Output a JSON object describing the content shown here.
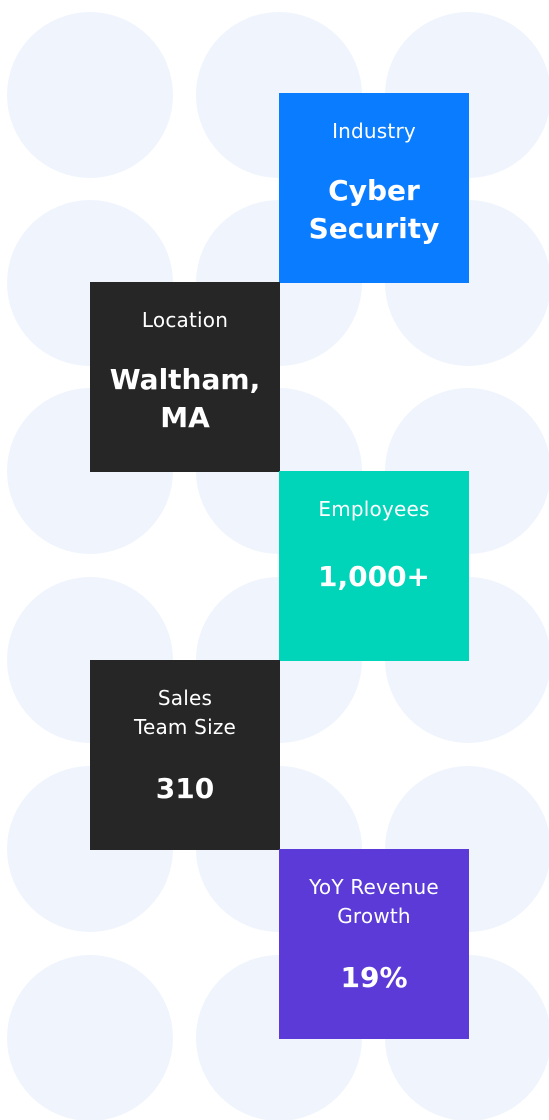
{
  "colors": {
    "circle": "#eff4fd",
    "industry_bg": "#0a7cff",
    "location_bg": "#262626",
    "employees_bg": "#00d4b9",
    "sales_bg": "#262626",
    "growth_bg": "#5b3ad8",
    "text": "#ffffff"
  },
  "stats": {
    "industry": {
      "label": "Industry",
      "value_line1": "Cyber",
      "value_line2": "Security"
    },
    "location": {
      "label": "Location",
      "value_line1": "Waltham,",
      "value_line2": "MA"
    },
    "employees": {
      "label": "Employees",
      "value": "1,000+"
    },
    "sales_team": {
      "label_line1": "Sales",
      "label_line2": "Team Size",
      "value": "310"
    },
    "revenue_growth": {
      "label_line1": "YoY Revenue",
      "label_line2": "Growth",
      "value": "19%"
    }
  }
}
